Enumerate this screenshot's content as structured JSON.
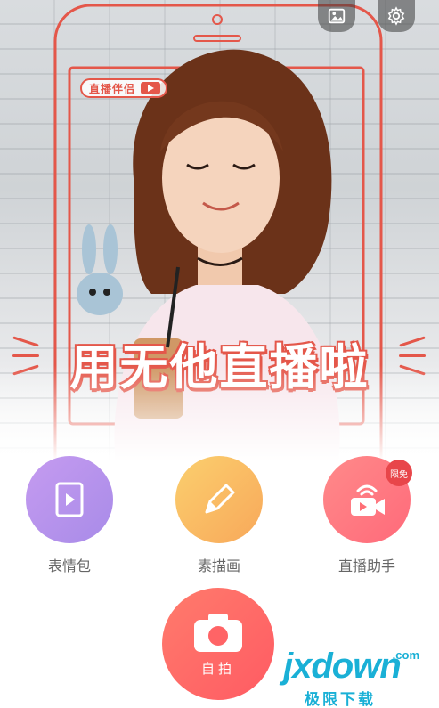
{
  "hero": {
    "live_badge": "直播伴侣",
    "slogan": "用无他直播啦"
  },
  "top_icons": [
    {
      "name": "gallery-icon"
    },
    {
      "name": "settings-icon"
    }
  ],
  "features": [
    {
      "label": "表情包",
      "icon": "sticker-play-icon"
    },
    {
      "label": "素描画",
      "icon": "pencil-icon"
    },
    {
      "label": "直播助手",
      "icon": "live-camera-icon",
      "badge": "限免"
    }
  ],
  "selfie": {
    "label": "自拍",
    "icon": "camera-icon"
  },
  "watermark": {
    "brand": "jxdown",
    "com": ".com",
    "cn": "极限下载"
  },
  "colors": {
    "accent": "#e4574a",
    "purple": "#b595ec",
    "orange": "#f9b862",
    "coral": "#ff6f76",
    "watermark": "#1ab0d6"
  }
}
